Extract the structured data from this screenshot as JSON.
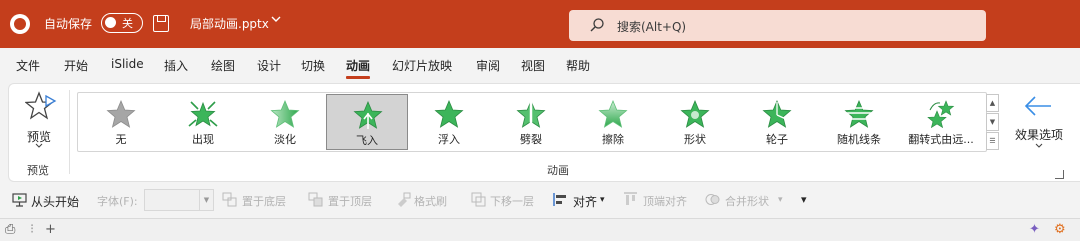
{
  "titlebar": {
    "autosave_label": "自动保存",
    "autosave_state": "关",
    "filename": "局部动画.pptx",
    "search_placeholder": "搜索(Alt+Q)",
    "bg_color": "#c43e1c"
  },
  "tabs": [
    {
      "label": "文件"
    },
    {
      "label": "开始"
    },
    {
      "label": "iSlide"
    },
    {
      "label": "插入"
    },
    {
      "label": "绘图"
    },
    {
      "label": "设计"
    },
    {
      "label": "切换"
    },
    {
      "label": "动画",
      "active": true
    },
    {
      "label": "幻灯片放映"
    },
    {
      "label": "审阅"
    },
    {
      "label": "视图"
    },
    {
      "label": "帮助"
    }
  ],
  "ribbon": {
    "preview": {
      "button_label": "预览",
      "group_label": "预览"
    },
    "animation_group_label": "动画",
    "animations": [
      {
        "name": "无",
        "icon": "star-none-icon"
      },
      {
        "name": "出现",
        "icon": "star-appear-icon"
      },
      {
        "name": "淡化",
        "icon": "star-fade-icon"
      },
      {
        "name": "飞入",
        "icon": "star-fly-in-icon",
        "selected": true
      },
      {
        "name": "浮入",
        "icon": "star-float-in-icon"
      },
      {
        "name": "劈裂",
        "icon": "star-split-icon"
      },
      {
        "name": "擦除",
        "icon": "star-wipe-icon"
      },
      {
        "name": "形状",
        "icon": "star-shape-icon"
      },
      {
        "name": "轮子",
        "icon": "star-wheel-icon"
      },
      {
        "name": "随机线条",
        "icon": "star-random-bars-icon"
      },
      {
        "name": "翻转式由远...",
        "icon": "star-grow-turn-icon"
      }
    ],
    "effect_options_label": "效果选项"
  },
  "toolbar2": {
    "from_beginning": "从头开始",
    "font_label": "字体(F):",
    "send_to_back": "置于底层",
    "bring_to_front": "置于顶层",
    "format_painter": "格式刷",
    "move_down": "下移一层",
    "align": "对齐",
    "align_top": "顶端对齐",
    "merge_shapes": "合并形状"
  },
  "colors": {
    "accent": "#c43e1c",
    "star_green": "#3cb55a",
    "star_gray": "#a6a6a6",
    "selected_bg": "#d3d3d3"
  }
}
